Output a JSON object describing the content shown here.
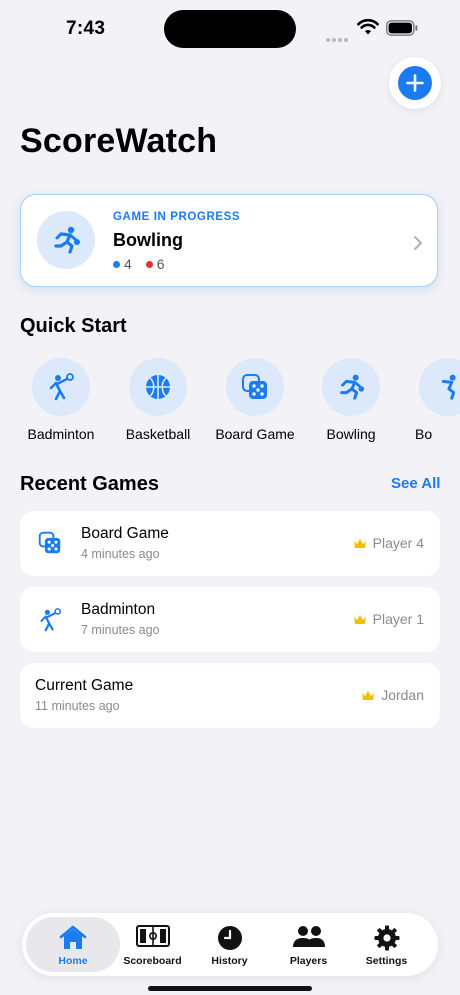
{
  "status": {
    "time": "7:43"
  },
  "app": {
    "title": "ScoreWatch"
  },
  "in_progress": {
    "label": "GAME IN PROGRESS",
    "game": "Bowling",
    "icon": "bowling-icon",
    "scores": [
      {
        "value": "4",
        "color": "#1a7cf0"
      },
      {
        "value": "6",
        "color": "#e3342f"
      }
    ]
  },
  "quick_start": {
    "title": "Quick Start",
    "items": [
      {
        "label": "Badminton",
        "icon": "badminton-icon"
      },
      {
        "label": "Basketball",
        "icon": "basketball-icon"
      },
      {
        "label": "Board Game",
        "icon": "dice-icon"
      },
      {
        "label": "Bowling",
        "icon": "bowling-icon"
      },
      {
        "label": "Bo",
        "icon": "bowling-icon"
      }
    ]
  },
  "recent": {
    "title": "Recent Games",
    "see_all": "See All",
    "games": [
      {
        "name": "Board Game",
        "time": "4 minutes ago",
        "winner": "Player 4",
        "icon": "dice-icon"
      },
      {
        "name": "Badminton",
        "time": "7 minutes ago",
        "winner": "Player 1",
        "icon": "badminton-icon"
      },
      {
        "name": "Current Game",
        "time": "11 minutes ago",
        "winner": "Jordan",
        "icon": ""
      }
    ]
  },
  "tabs": [
    {
      "label": "Home",
      "icon": "house-icon",
      "active": true
    },
    {
      "label": "Scoreboard",
      "icon": "scoreboard-icon",
      "active": false
    },
    {
      "label": "History",
      "icon": "clock-icon",
      "active": false
    },
    {
      "label": "Players",
      "icon": "people-icon",
      "active": false
    },
    {
      "label": "Settings",
      "icon": "gear-icon",
      "active": false
    }
  ],
  "colors": {
    "accent": "#1a7cf0",
    "crown": "#f2c200",
    "background": "#f2f2f7"
  }
}
